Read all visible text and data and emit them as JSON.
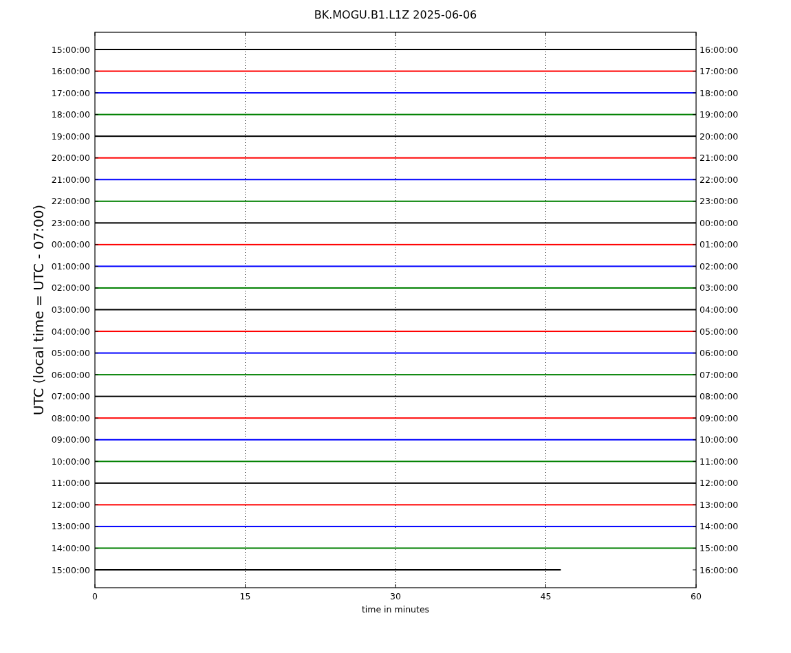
{
  "title": "BK.MOGU.B1.L1Z 2025-06-06",
  "y_axis_label": "UTC (local time = UTC - 07:00)",
  "x_axis_label": "time in minutes",
  "x_ticks": [
    "0",
    "15",
    "30",
    "45",
    "60"
  ],
  "traces": [
    {
      "left_label": "15:00:00",
      "right_label": "16:00:00",
      "color": "#000000",
      "level": 1
    },
    {
      "left_label": "16:00:00",
      "right_label": "17:00:00",
      "color": "#ff0000",
      "level": 1
    },
    {
      "left_label": "17:00:00",
      "right_label": "18:00:00",
      "color": "#0000ff",
      "level": 1
    },
    {
      "left_label": "18:00:00",
      "right_label": "19:00:00",
      "color": "#008000",
      "level": 1
    },
    {
      "left_label": "19:00:00",
      "right_label": "20:00:00",
      "color": "#000000",
      "level": 1
    },
    {
      "left_label": "20:00:00",
      "right_label": "21:00:00",
      "color": "#ff0000",
      "level": 1
    },
    {
      "left_label": "21:00:00",
      "right_label": "22:00:00",
      "color": "#0000ff",
      "level": 1
    },
    {
      "left_label": "22:00:00",
      "right_label": "23:00:00",
      "color": "#008000",
      "level": 1
    },
    {
      "left_label": "23:00:00",
      "right_label": "00:00:00",
      "color": "#000000",
      "level": 1
    },
    {
      "left_label": "00:00:00",
      "right_label": "01:00:00",
      "color": "#ff0000",
      "level": 1
    },
    {
      "left_label": "01:00:00",
      "right_label": "02:00:00",
      "color": "#0000ff",
      "level": 1
    },
    {
      "left_label": "02:00:00",
      "right_label": "03:00:00",
      "color": "#008000",
      "level": 1
    },
    {
      "left_label": "03:00:00",
      "right_label": "04:00:00",
      "color": "#000000",
      "level": 1
    },
    {
      "left_label": "04:00:00",
      "right_label": "05:00:00",
      "color": "#ff0000",
      "level": 1
    },
    {
      "left_label": "05:00:00",
      "right_label": "06:00:00",
      "color": "#0000ff",
      "level": 1
    },
    {
      "left_label": "06:00:00",
      "right_label": "07:00:00",
      "color": "#008000",
      "level": 1
    },
    {
      "left_label": "07:00:00",
      "right_label": "08:00:00",
      "color": "#000000",
      "level": 1
    },
    {
      "left_label": "08:00:00",
      "right_label": "09:00:00",
      "color": "#ff0000",
      "level": 1
    },
    {
      "left_label": "09:00:00",
      "right_label": "10:00:00",
      "color": "#0000ff",
      "level": 1
    },
    {
      "left_label": "10:00:00",
      "right_label": "11:00:00",
      "color": "#008000",
      "level": 1
    },
    {
      "left_label": "11:00:00",
      "right_label": "12:00:00",
      "color": "#000000",
      "level": 1
    },
    {
      "left_label": "12:00:00",
      "right_label": "13:00:00",
      "color": "#ff0000",
      "level": 1
    },
    {
      "left_label": "13:00:00",
      "right_label": "14:00:00",
      "color": "#0000ff",
      "level": 1
    },
    {
      "left_label": "14:00:00",
      "right_label": "15:00:00",
      "color": "#008000",
      "level": 1
    },
    {
      "left_label": "15:00:00",
      "right_label": "16:00:00",
      "color": "#000000",
      "level": 0.775
    }
  ]
}
